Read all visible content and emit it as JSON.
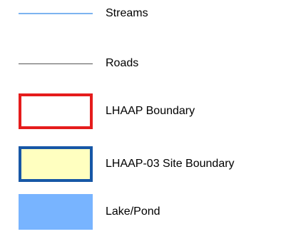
{
  "legend": {
    "items": [
      {
        "label": "Streams",
        "symbol": "line",
        "color": "#7db4f0"
      },
      {
        "label": "Roads",
        "symbol": "line",
        "color": "#555555"
      },
      {
        "label": "LHAAP Boundary",
        "symbol": "outlined-box",
        "stroke": "#e51c1c",
        "fill": "#ffffff"
      },
      {
        "label": "LHAAP-03 Site Boundary",
        "symbol": "outlined-box",
        "stroke": "#1757a6",
        "fill": "#ffffc0"
      },
      {
        "label": "Lake/Pond",
        "symbol": "filled-box",
        "fill": "#78b4ff"
      }
    ]
  }
}
